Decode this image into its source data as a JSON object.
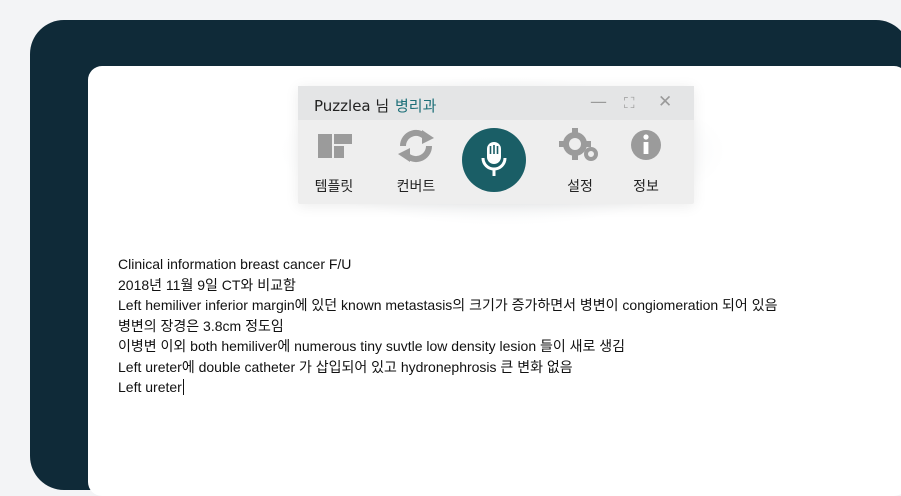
{
  "toolbar": {
    "user": "Puzzlea 님",
    "department": "병리과",
    "window_controls": {
      "minimize": "—",
      "maximize": "⛶",
      "close": "✕"
    },
    "buttons": [
      {
        "label": "템플릿",
        "icon": "template-icon"
      },
      {
        "label": "컨버트",
        "icon": "convert-icon"
      },
      {
        "label": "",
        "icon": "microphone-icon"
      },
      {
        "label": "설정",
        "icon": "gear-icon"
      },
      {
        "label": "정보",
        "icon": "info-icon"
      }
    ],
    "colors": {
      "accent": "#1a5e66",
      "icon_gray": "#9b9b9b",
      "frame": "#0f2a38"
    }
  },
  "document": {
    "lines": [
      "Clinical information breast cancer F/U",
      "2018년 11월 9일 CT와 비교함",
      "Left hemiliver inferior margin에 있던 known metastasis의 크기가 증가하면서 병변이 congiomeration 되어 있음",
      "병변의 장경은 3.8cm 정도임",
      "이병변 이외 both hemiliver에 numerous tiny suvtle low density lesion 들이 새로 생김",
      "Left ureter에 double catheter 가 삽입되어 있고 hydronephrosis 큰 변화 없음",
      "Left ureter"
    ]
  }
}
